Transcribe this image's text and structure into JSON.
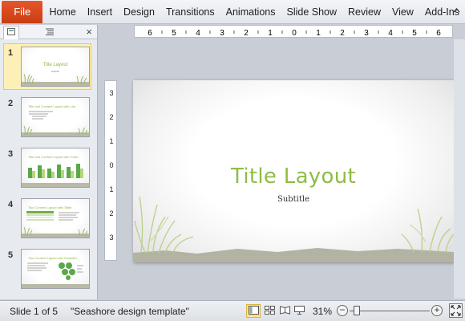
{
  "ribbon": {
    "file_label": "File",
    "tabs": [
      "Home",
      "Insert",
      "Design",
      "Transitions",
      "Animations",
      "Slide Show",
      "Review",
      "View",
      "Add-Ins"
    ]
  },
  "panel": {
    "close_icon": "×",
    "thumbnails": [
      {
        "number": "1",
        "title": "Title Layout",
        "subtitle": "Subtitle",
        "selected": true
      },
      {
        "number": "2",
        "title": "Title and Content Layout with List",
        "subtitle": "",
        "selected": false
      },
      {
        "number": "3",
        "title": "Title and Content Layout with Chart",
        "subtitle": "",
        "selected": false
      },
      {
        "number": "4",
        "title": "Two Content Layout with Table",
        "subtitle": "",
        "selected": false
      },
      {
        "number": "5",
        "title": "Two Content Layout with SmartArt",
        "subtitle": "",
        "selected": false
      }
    ]
  },
  "ruler": {
    "horizontal": [
      "6",
      "5",
      "4",
      "3",
      "2",
      "1",
      "0",
      "1",
      "2",
      "3",
      "4",
      "5",
      "6"
    ],
    "vertical": [
      "3",
      "2",
      "1",
      "0",
      "1",
      "2",
      "3"
    ]
  },
  "slide": {
    "title": "Title Layout",
    "subtitle": "Subtitle",
    "accent_color": "#8fbc46"
  },
  "status": {
    "slide_indicator": "Slide 1 of 5",
    "theme_name": "\"Seashore design template\"",
    "zoom_percent": "31%",
    "zoom_level": 0.31,
    "zoom_minus": "−",
    "zoom_plus": "+"
  }
}
